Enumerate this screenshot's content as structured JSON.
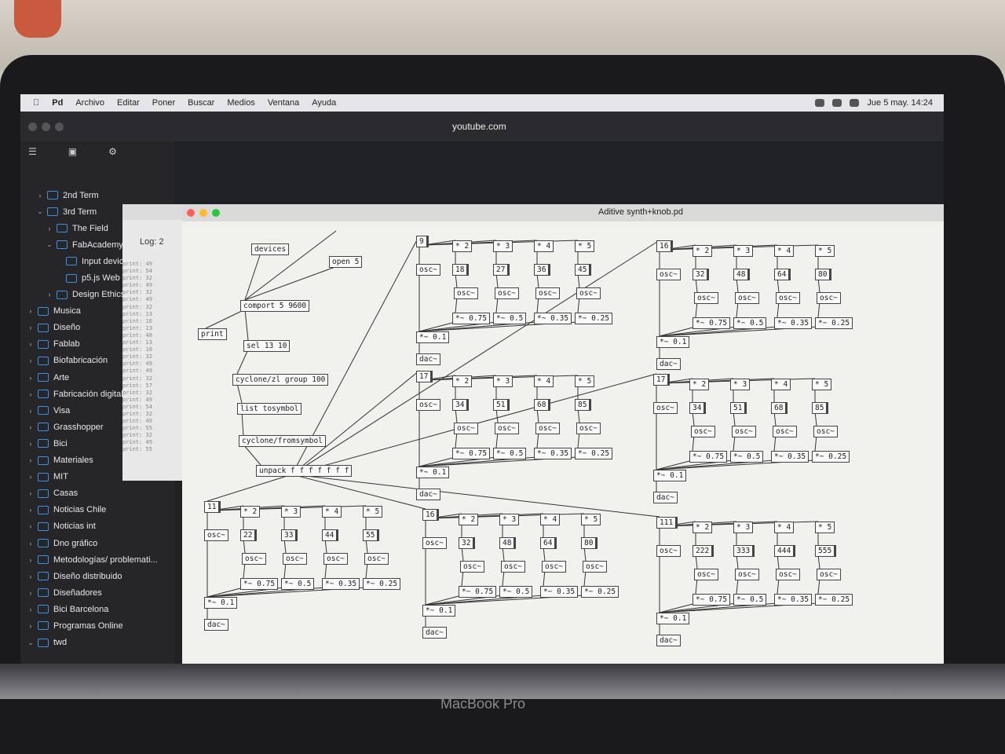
{
  "menubar": {
    "app": "Pd",
    "items": [
      "Archivo",
      "Editar",
      "Poner",
      "Buscar",
      "Medios",
      "Ventana",
      "Ayuda"
    ],
    "clock": "Jue 5 may.  14:24"
  },
  "browser": {
    "url": "youtube.com"
  },
  "sidebar": {
    "items": [
      {
        "label": "2nd Term",
        "depth": 1,
        "open": false
      },
      {
        "label": "3rd Term",
        "depth": 1,
        "open": true
      },
      {
        "label": "The Field",
        "depth": 2,
        "open": false
      },
      {
        "label": "FabAcademy",
        "depth": 2,
        "open": true
      },
      {
        "label": "Input device",
        "depth": 3,
        "open": null
      },
      {
        "label": "p5.js Web E",
        "depth": 3,
        "open": null
      },
      {
        "label": "Design Ethics",
        "depth": 2,
        "open": false
      },
      {
        "label": "Musica",
        "depth": 0,
        "open": false
      },
      {
        "label": "Diseño",
        "depth": 0,
        "open": false
      },
      {
        "label": "Fablab",
        "depth": 0,
        "open": false
      },
      {
        "label": "Biofabricación",
        "depth": 0,
        "open": false
      },
      {
        "label": "Arte",
        "depth": 0,
        "open": false
      },
      {
        "label": "Fabricación digital",
        "depth": 0,
        "open": false
      },
      {
        "label": "Visa",
        "depth": 0,
        "open": false
      },
      {
        "label": "Grasshopper",
        "depth": 0,
        "open": false
      },
      {
        "label": "Bici",
        "depth": 0,
        "open": false
      },
      {
        "label": "Materiales",
        "depth": 0,
        "open": false
      },
      {
        "label": "MIT",
        "depth": 0,
        "open": false
      },
      {
        "label": "Casas",
        "depth": 0,
        "open": false
      },
      {
        "label": "Noticias Chile",
        "depth": 0,
        "open": false
      },
      {
        "label": "Noticias int",
        "depth": 0,
        "open": false
      },
      {
        "label": "Dno gráfico",
        "depth": 0,
        "open": false
      },
      {
        "label": "Metodologías/ problemati...",
        "depth": 0,
        "open": false
      },
      {
        "label": "Diseño distribuido",
        "depth": 0,
        "open": false
      },
      {
        "label": "Diseñadores",
        "depth": 0,
        "open": false
      },
      {
        "label": "Bici Barcelona",
        "depth": 0,
        "open": false
      },
      {
        "label": "Programas Online",
        "depth": 0,
        "open": false
      },
      {
        "label": "twd",
        "depth": 0,
        "open": true
      }
    ]
  },
  "log": {
    "label": "Log:",
    "level": "2",
    "lines": [
      "print: 49",
      "print: 54",
      "print: 32",
      "print: 49",
      "print: 32",
      "print: 49",
      "print: 32",
      "print: 13",
      "print: 10",
      "print: 13",
      "print: 48",
      "print: 13",
      "print: 10",
      "print: 32",
      "print: 49",
      "print: 49",
      "print: 32",
      "print: 57",
      "print: 32",
      "print: 49",
      "print: 54",
      "print: 32",
      "print: 49",
      "print: 55",
      "print: 32",
      "print: 49",
      "print: 55"
    ]
  },
  "patch": {
    "title": "Aditive synth+knob.pd",
    "control_objects": [
      "devices",
      "open 5",
      "comport 5 9600",
      "print",
      "sel 13 10",
      "cyclone/zl group 100",
      "list tosymbol",
      "cyclone/fromsymbol",
      "unpack f f f f f f f"
    ],
    "voice_labels": {
      "mul2": "* 2",
      "mul3": "* 3",
      "mul4": "* 4",
      "mul5": "* 5",
      "osc": "osc~",
      "g1": "*~ 0.75",
      "g2": "*~ 0.5",
      "g3": "*~ 0.35",
      "g4": "*~ 0.25",
      "master": "*~ 0.1",
      "dac": "dac~"
    },
    "voices": [
      {
        "base": "9",
        "h2": "18",
        "h3": "27",
        "h4": "36",
        "h5": "45"
      },
      {
        "base": "16",
        "h2": "32",
        "h3": "48",
        "h4": "64",
        "h5": "80"
      },
      {
        "base": "17",
        "h2": "34",
        "h3": "51",
        "h4": "68",
        "h5": "85"
      },
      {
        "base": "17",
        "h2": "34",
        "h3": "51",
        "h4": "68",
        "h5": "85"
      },
      {
        "base": "11",
        "h2": "22",
        "h3": "33",
        "h4": "44",
        "h5": "55"
      },
      {
        "base": "16",
        "h2": "32",
        "h3": "48",
        "h4": "64",
        "h5": "80"
      },
      {
        "base": "111",
        "h2": "222",
        "h3": "333",
        "h4": "444",
        "h5": "555"
      }
    ]
  },
  "footer": {
    "brand": "MacBook Pro"
  },
  "colors": {
    "accent": "#3a8fe6",
    "close": "#ff5f57",
    "min": "#febc2e",
    "max": "#28c840"
  }
}
